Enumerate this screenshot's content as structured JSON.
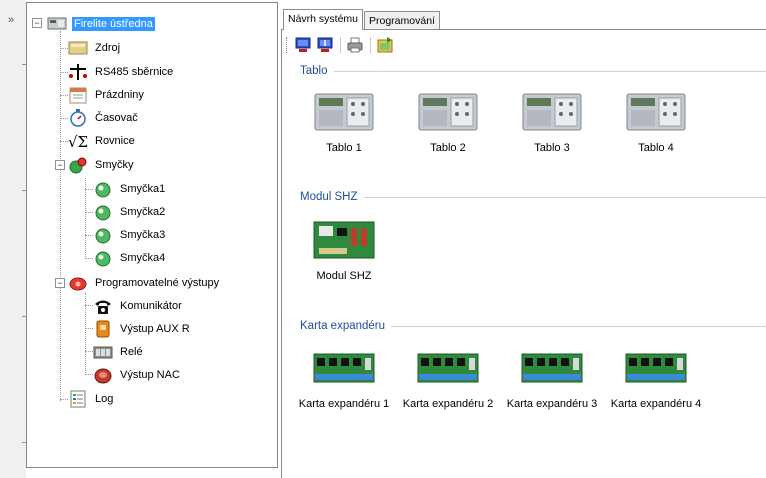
{
  "tree": {
    "root": {
      "label": "Firelite ústředna",
      "expander": "−"
    },
    "items": [
      {
        "label": "Zdroj",
        "icon": "power-supply-icon"
      },
      {
        "label": "RS485 sběrnice",
        "icon": "bus-icon"
      },
      {
        "label": "Prázdniny",
        "icon": "calendar-icon"
      },
      {
        "label": "Časovač",
        "icon": "stopwatch-icon"
      },
      {
        "label": "Rovnice",
        "icon": "equation-icon"
      }
    ],
    "loops": {
      "label": "Smyčky",
      "expander": "−",
      "children": [
        {
          "label": "Smyčka1"
        },
        {
          "label": "Smyčka2"
        },
        {
          "label": "Smyčka3"
        },
        {
          "label": "Smyčka4"
        }
      ]
    },
    "outputs": {
      "label": "Programovatelné výstupy",
      "expander": "−",
      "children": [
        {
          "label": "Komunikátor",
          "icon": "telephone-icon"
        },
        {
          "label": "Výstup AUX R",
          "icon": "aux-output-icon"
        },
        {
          "label": "Relé",
          "icon": "relay-icon"
        },
        {
          "label": "Výstup NAC",
          "icon": "bell-icon"
        }
      ]
    },
    "log": {
      "label": "Log"
    }
  },
  "tabs": [
    {
      "label": "Návrh systému",
      "active": true
    },
    {
      "label": "Programování",
      "active": false
    }
  ],
  "toolbar": {
    "buttons": [
      "computer-upload-icon",
      "computer-download-icon",
      "printer-icon",
      "export-icon"
    ]
  },
  "groups": {
    "tablo": {
      "title": "Tablo",
      "devices": [
        {
          "label": "Tablo 1"
        },
        {
          "label": "Tablo 2"
        },
        {
          "label": "Tablo 3"
        },
        {
          "label": "Tablo 4"
        }
      ]
    },
    "shz": {
      "title": "Modul SHZ",
      "devices": [
        {
          "label": "Modul SHZ"
        }
      ]
    },
    "expander": {
      "title": "Karta expandéru",
      "devices": [
        {
          "label": "Karta expandéru 1"
        },
        {
          "label": "Karta expandéru 2"
        },
        {
          "label": "Karta expandéru 3"
        },
        {
          "label": "Karta expandéru 4"
        }
      ]
    }
  },
  "colors": {
    "selection": "#3399ff",
    "group_title": "#1f4e9a",
    "panel_border": "#828790"
  }
}
